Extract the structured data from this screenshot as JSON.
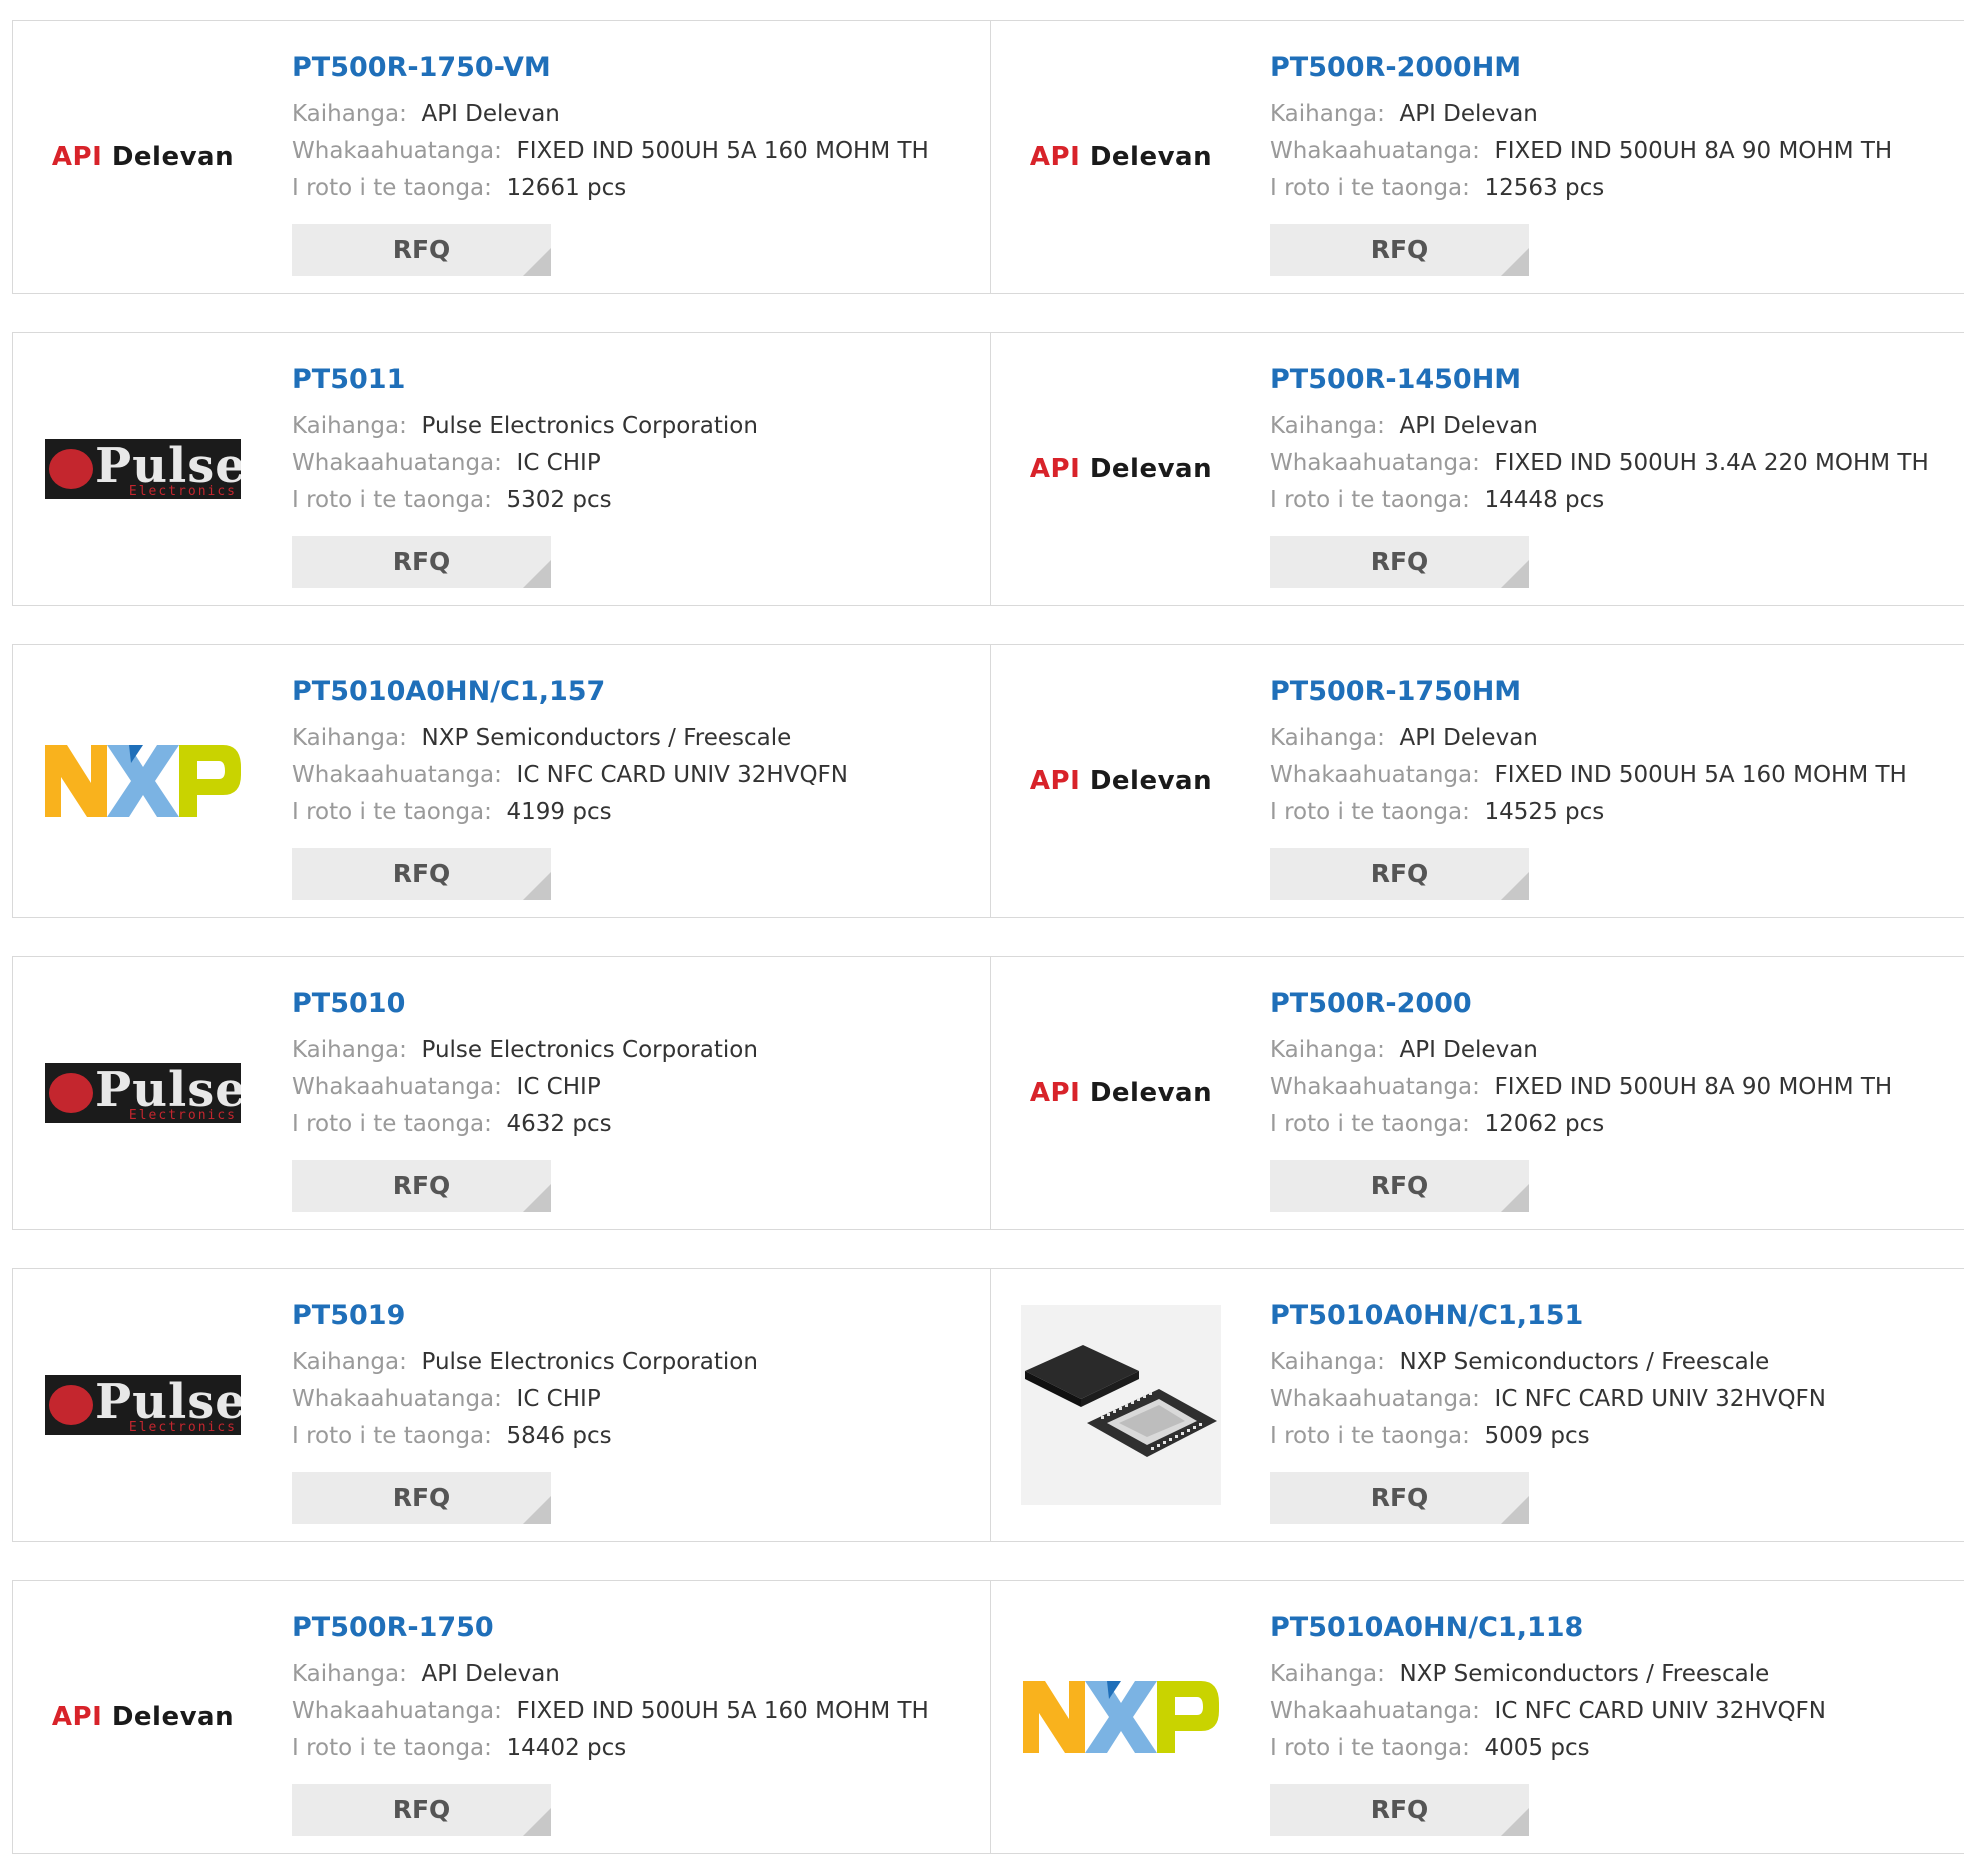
{
  "labels": {
    "manufacturer": "Kaihanga:",
    "description": "Whakaahuatanga:",
    "stock": "I roto i te taonga:",
    "rfq": "RFQ"
  },
  "brands": {
    "api": [
      "API",
      "Delevan"
    ],
    "pulse": [
      "Pulse",
      "Electronics"
    ]
  },
  "products": [
    {
      "part": "PT500R-1750-VM",
      "logo": "api",
      "manufacturer": "API Delevan",
      "description": "FIXED IND 500UH 5A 160 MOHM TH",
      "stock": "12661 pcs"
    },
    {
      "part": "PT500R-2000HM",
      "logo": "api",
      "manufacturer": "API Delevan",
      "description": "FIXED IND 500UH 8A 90 MOHM TH",
      "stock": "12563 pcs"
    },
    {
      "part": "PT5011",
      "logo": "pulse",
      "manufacturer": "Pulse Electronics Corporation",
      "description": "IC CHIP",
      "stock": "5302 pcs"
    },
    {
      "part": "PT500R-1450HM",
      "logo": "api",
      "manufacturer": "API Delevan",
      "description": "FIXED IND 500UH 3.4A 220 MOHM TH",
      "stock": "14448 pcs"
    },
    {
      "part": "PT5010A0HN/C1,157",
      "logo": "nxp",
      "manufacturer": "NXP Semiconductors / Freescale",
      "description": "IC NFC CARD UNIV 32HVQFN",
      "stock": "4199 pcs"
    },
    {
      "part": "PT500R-1750HM",
      "logo": "api",
      "manufacturer": "API Delevan",
      "description": "FIXED IND 500UH 5A 160 MOHM TH",
      "stock": "14525 pcs"
    },
    {
      "part": "PT5010",
      "logo": "pulse",
      "manufacturer": "Pulse Electronics Corporation",
      "description": "IC CHIP",
      "stock": "4632 pcs"
    },
    {
      "part": "PT500R-2000",
      "logo": "api",
      "manufacturer": "API Delevan",
      "description": "FIXED IND 500UH 8A 90 MOHM TH",
      "stock": "12062 pcs"
    },
    {
      "part": "PT5019",
      "logo": "pulse",
      "manufacturer": "Pulse Electronics Corporation",
      "description": "IC CHIP",
      "stock": "5846 pcs"
    },
    {
      "part": "PT5010A0HN/C1,151",
      "logo": "chip",
      "manufacturer": "NXP Semiconductors / Freescale",
      "description": "IC NFC CARD UNIV 32HVQFN",
      "stock": "5009 pcs"
    },
    {
      "part": "PT500R-1750",
      "logo": "api",
      "manufacturer": "API Delevan",
      "description": "FIXED IND 500UH 5A 160 MOHM TH",
      "stock": "14402 pcs"
    },
    {
      "part": "PT5010A0HN/C1,118",
      "logo": "nxp",
      "manufacturer": "NXP Semiconductors / Freescale",
      "description": "IC NFC CARD UNIV 32HVQFN",
      "stock": "4005 pcs"
    }
  ]
}
